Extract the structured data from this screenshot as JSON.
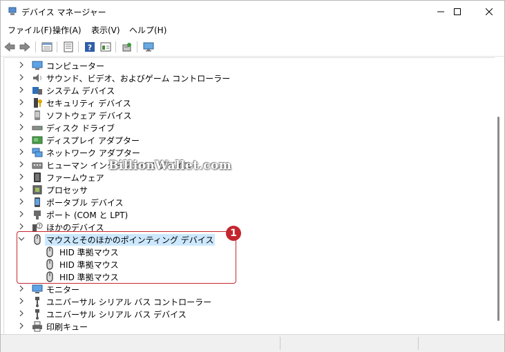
{
  "window": {
    "title": "デバイス マネージャー"
  },
  "menu": [
    {
      "label": "ファイル(F)"
    },
    {
      "label": "操作(A)"
    },
    {
      "label": "表示(V)"
    },
    {
      "label": "ヘルプ(H)"
    }
  ],
  "toolbar_icons": [
    "back-icon",
    "forward-icon",
    "properties-grid-icon",
    "properties-doc-icon",
    "help-icon",
    "view-icon",
    "scan-hardware-icon",
    "monitor-icon"
  ],
  "tree": {
    "categories": [
      {
        "label": "コンピューター",
        "icon": "computer-icon"
      },
      {
        "label": "サウンド、ビデオ、およびゲーム コントローラー",
        "icon": "speaker-icon"
      },
      {
        "label": "システム デバイス",
        "icon": "system-device-icon"
      },
      {
        "label": "セキュリティ デバイス",
        "icon": "security-key-icon"
      },
      {
        "label": "ソフトウェア デバイス",
        "icon": "software-device-icon"
      },
      {
        "label": "ディスク ドライブ",
        "icon": "disk-drive-icon"
      },
      {
        "label": "ディスプレイ アダプター",
        "icon": "display-adapter-icon"
      },
      {
        "label": "ネットワーク アダプター",
        "icon": "network-adapter-icon"
      },
      {
        "label": "ヒューマン インターフェイス デバイス",
        "icon": "hid-icon"
      },
      {
        "label": "ファームウェア",
        "icon": "firmware-icon"
      },
      {
        "label": "プロセッサ",
        "icon": "processor-icon"
      },
      {
        "label": "ポータブル デバイス",
        "icon": "portable-device-icon"
      },
      {
        "label": "ポート (COM と LPT)",
        "icon": "port-icon"
      },
      {
        "label": "ほかのデバイス",
        "icon": "unknown-device-icon"
      },
      {
        "label": "マウスとそのほかのポインティング デバイス",
        "icon": "mouse-icon",
        "expanded": true,
        "selected": true
      },
      {
        "label": "モニター",
        "icon": "monitor-icon"
      },
      {
        "label": "ユニバーサル シリアル バス コントローラー",
        "icon": "usb-icon"
      },
      {
        "label": "ユニバーサル シリアル バス デバイス",
        "icon": "usb-icon"
      },
      {
        "label": "印刷キュー",
        "icon": "printer-icon"
      }
    ],
    "mouse_children": [
      {
        "label": "HID 準拠マウス",
        "icon": "mouse-icon"
      },
      {
        "label": "HID 準拠マウス",
        "icon": "mouse-icon"
      },
      {
        "label": "HID 準拠マウス",
        "icon": "mouse-icon"
      }
    ]
  },
  "annotation": {
    "badge": "1",
    "color": "#c4262e"
  },
  "watermark": "BillionWallet.com",
  "colors": {
    "selection": "#cce8ff",
    "accent": "#c4262e"
  }
}
